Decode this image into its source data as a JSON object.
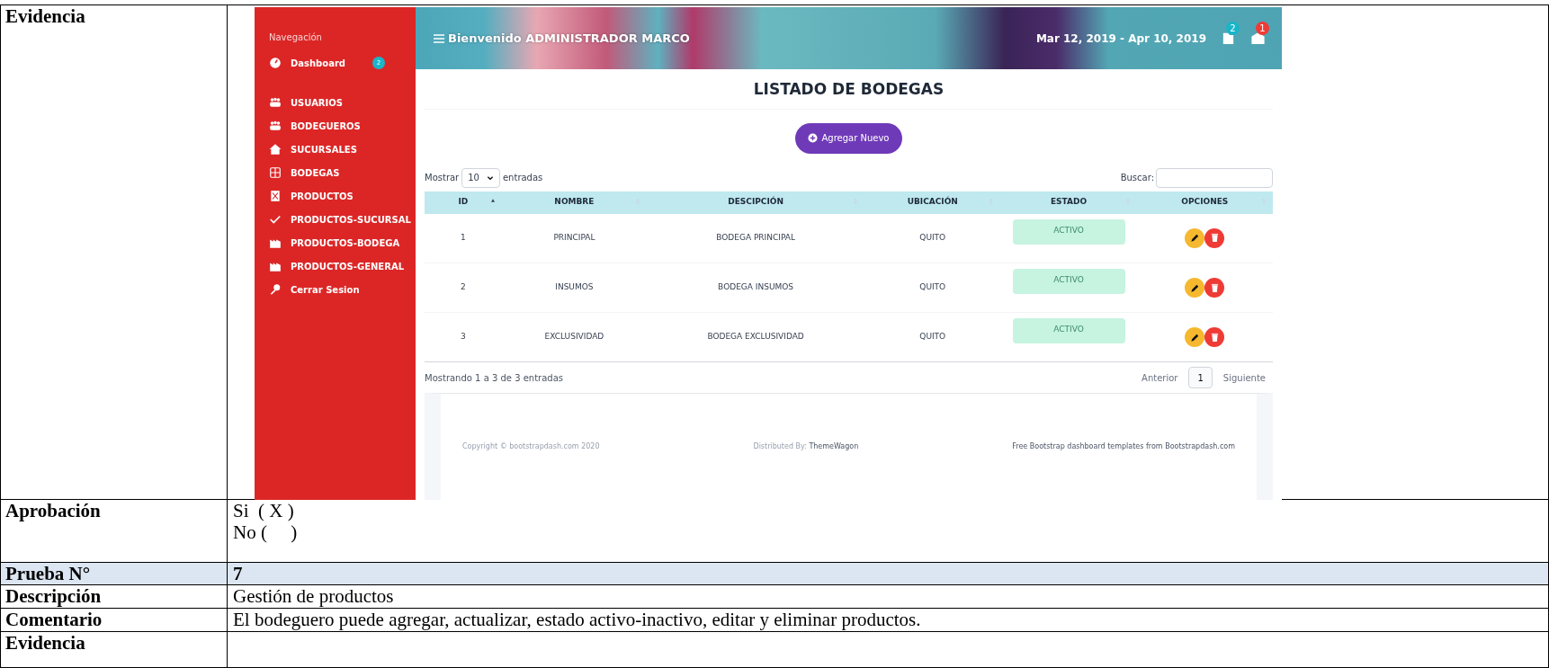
{
  "document_rows": [
    {
      "label": "Evidencia",
      "kind": "screenshot"
    },
    {
      "label": "Aprobación",
      "kind": "lines",
      "lines": [
        "Si  ( X )",
        "No (     )"
      ]
    },
    {
      "label": "Prueba N°",
      "kind": "heading",
      "value": "7"
    },
    {
      "label": "Descripción",
      "kind": "text",
      "value": "Gestión de productos"
    },
    {
      "label": "Comentario",
      "kind": "text",
      "value": "El bodeguero puede agregar, actualizar, estado activo-inactivo,  editar y eliminar productos."
    },
    {
      "label": "Evidencia",
      "kind": "empty"
    }
  ],
  "app": {
    "sidebar": {
      "heading": "Navegación",
      "items": [
        {
          "label": "Dashboard",
          "badge": "2"
        },
        {
          "label": "USUARIOS"
        },
        {
          "label": "BODEGUEROS"
        },
        {
          "label": "SUCURSALES"
        },
        {
          "label": "BODEGAS"
        },
        {
          "label": "PRODUCTOS"
        },
        {
          "label": "PRODUCTOS-SUCURSAL"
        },
        {
          "label": "PRODUCTOS-BODEGA"
        },
        {
          "label": "PRODUCTOS-GENERAL"
        },
        {
          "label": "Cerrar Sesion"
        }
      ]
    },
    "header": {
      "greeting": "Bienvenido ADMINISTRADOR MARCO",
      "date_range": "Mar 12, 2019 - Apr 10, 2019",
      "notification_badges": [
        "2",
        "1"
      ]
    },
    "page_title": "LISTADO DE BODEGAS",
    "add_button": "Agregar Nuevo",
    "length_control": {
      "before": "Mostrar",
      "value": "10",
      "after": "entradas"
    },
    "search_label": "Buscar:",
    "table": {
      "columns": [
        {
          "label": "ID",
          "sorted": true
        },
        {
          "label": "NOMBRE",
          "sorted": false
        },
        {
          "label": "DESCIPCIÓN",
          "sorted": false
        },
        {
          "label": "UBICACIÓN",
          "sorted": false
        },
        {
          "label": "ESTADO",
          "sorted": false
        },
        {
          "label": "OPCIONES",
          "sorted": false
        }
      ],
      "rows": [
        {
          "id": "1",
          "name": "PRINCIPAL",
          "description": "BODEGA PRINCIPAL",
          "location": "QUITO",
          "status": "ACTIVO"
        },
        {
          "id": "2",
          "name": "INSUMOS",
          "description": "BODEGA INSUMOS",
          "location": "QUITO",
          "status": "ACTIVO"
        },
        {
          "id": "3",
          "name": "EXCLUSIVIDAD",
          "description": "BODEGA EXCLUSIVIDAD",
          "location": "QUITO",
          "status": "ACTIVO"
        }
      ]
    },
    "info": "Mostrando 1 a 3 de 3 entradas",
    "pagination": [
      {
        "label": "Anterior",
        "selected": false
      },
      {
        "label": "1",
        "selected": true
      },
      {
        "label": "Siguiente",
        "selected": false
      }
    ],
    "footer": {
      "copyright": "Copyright © bootstrapdash.com 2020",
      "distributed_label": "Distributed By:",
      "distributed_link": "ThemeWagon",
      "templates": "Free Bootstrap dashboard templates from Bootstrapdash.com"
    }
  }
}
